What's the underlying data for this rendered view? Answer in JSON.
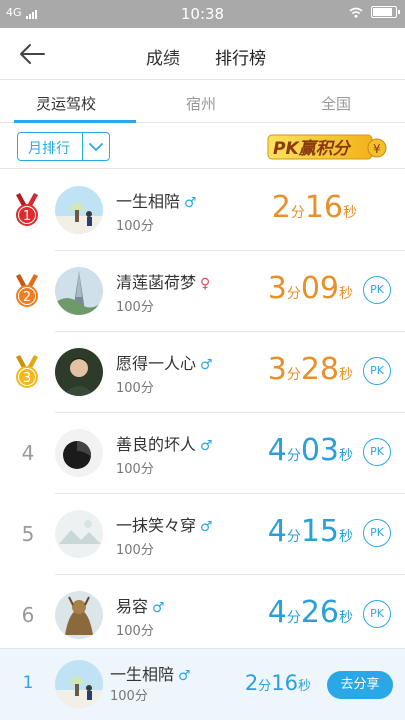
{
  "status_bar": {
    "network": "4G",
    "time": "10:38"
  },
  "nav": {
    "back_icon": "back-arrow-icon",
    "tabs": [
      "成绩",
      "排行榜"
    ],
    "active_tab": "排行榜"
  },
  "region_tabs": {
    "items": [
      "灵运驾校",
      "宿州",
      "全国"
    ],
    "active": "灵运驾校"
  },
  "filter": {
    "month_label": "月排行",
    "pk_banner": "PK赢积分",
    "pk_coin": "¥"
  },
  "colors": {
    "accent": "#2aa7e6",
    "orange": "#e8902a",
    "blue_time": "#2a9fd9",
    "male": "#2aa7e6",
    "female": "#e84c5b"
  },
  "rankings": [
    {
      "rank": "1",
      "name": "一生相陪",
      "gender": "♂",
      "score": "100分",
      "min": "2",
      "min_unit": "分",
      "sec": "16",
      "sec_unit": "秒",
      "pk": ""
    },
    {
      "rank": "2",
      "name": "清莲菡荷梦",
      "gender": "♀",
      "score": "100分",
      "min": "3",
      "min_unit": "分",
      "sec": "09",
      "sec_unit": "秒",
      "pk": "PK"
    },
    {
      "rank": "3",
      "name": "愿得一人心",
      "gender": "♂",
      "score": "100分",
      "min": "3",
      "min_unit": "分",
      "sec": "28",
      "sec_unit": "秒",
      "pk": "PK"
    },
    {
      "rank": "4",
      "name": "善良的坏人",
      "gender": "♂",
      "score": "100分",
      "min": "4",
      "min_unit": "分",
      "sec": "03",
      "sec_unit": "秒",
      "pk": "PK"
    },
    {
      "rank": "5",
      "name": "一抹笑々穿",
      "gender": "♂",
      "score": "100分",
      "min": "4",
      "min_unit": "分",
      "sec": "15",
      "sec_unit": "秒",
      "pk": "PK"
    },
    {
      "rank": "6",
      "name": "易容",
      "gender": "♂",
      "score": "100分",
      "min": "4",
      "min_unit": "分",
      "sec": "26",
      "sec_unit": "秒",
      "pk": "PK"
    }
  ],
  "my_rank": {
    "rank": "1",
    "name": "一生相陪",
    "gender": "♂",
    "score": "100分",
    "min": "2",
    "min_unit": "分",
    "sec": "16",
    "sec_unit": "秒",
    "share_label": "去分享"
  }
}
